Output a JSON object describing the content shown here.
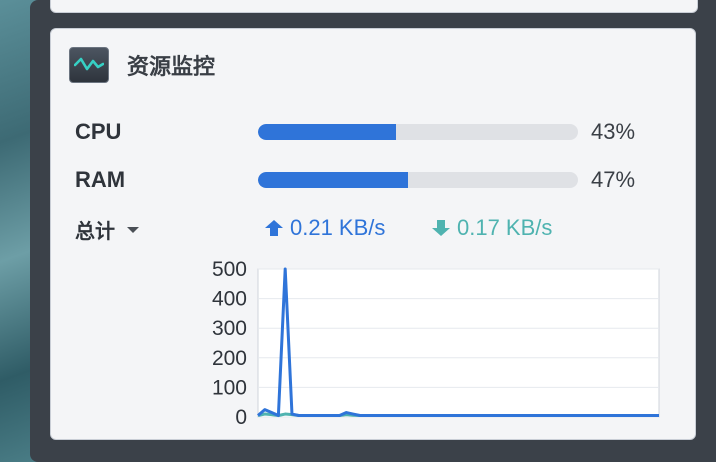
{
  "widget": {
    "title": "资源监控",
    "icon": "activity-monitor-icon"
  },
  "resources": [
    {
      "label": "CPU",
      "percent_text": "43%",
      "value": 0.43
    },
    {
      "label": "RAM",
      "percent_text": "47%",
      "value": 0.47
    }
  ],
  "network": {
    "filter_label": "总计",
    "upload": {
      "value": "0.21 KB/s",
      "icon": "upload-arrow-icon"
    },
    "download": {
      "value": "0.17 KB/s",
      "icon": "download-arrow-icon"
    }
  },
  "colors": {
    "accent": "#2f74d9",
    "upload": "#2f74d9",
    "download": "#4fb3b0",
    "bar_track": "#dfe1e5"
  },
  "chart_data": {
    "type": "line",
    "xlabel": "",
    "ylabel": "",
    "ylim": [
      0,
      500
    ],
    "yticks": [
      "500",
      "400",
      "300",
      "200",
      "100",
      "0"
    ],
    "x": [
      0,
      1,
      2,
      3,
      4,
      5,
      6,
      7,
      8,
      9,
      10,
      11,
      12,
      13,
      14,
      15,
      16,
      17,
      18,
      19,
      20,
      21,
      22,
      23,
      24,
      25,
      26,
      27,
      28,
      29,
      30,
      31,
      32,
      33,
      34,
      35,
      36,
      37,
      38,
      39,
      40,
      41,
      42,
      43,
      44,
      45,
      46,
      47,
      48,
      49,
      50,
      51,
      52,
      53,
      54,
      55,
      56,
      57,
      58,
      59
    ],
    "series": [
      {
        "values": [
          5,
          25,
          15,
          5,
          500,
          10,
          5,
          5,
          5,
          5,
          5,
          5,
          5,
          15,
          10,
          5,
          5,
          5,
          5,
          5,
          5,
          5,
          5,
          5,
          5,
          5,
          5,
          5,
          5,
          5,
          5,
          5,
          5,
          5,
          5,
          5,
          5,
          5,
          5,
          5,
          5,
          5,
          5,
          5,
          5,
          5,
          5,
          5,
          5,
          5,
          5,
          5,
          5,
          5,
          5,
          5,
          5,
          5,
          5,
          5
        ],
        "color": "#2f74d9"
      },
      {
        "values": [
          5,
          10,
          8,
          5,
          10,
          8,
          5,
          5,
          5,
          5,
          5,
          5,
          5,
          8,
          6,
          5,
          5,
          5,
          5,
          5,
          5,
          5,
          5,
          5,
          5,
          5,
          5,
          5,
          5,
          5,
          5,
          5,
          5,
          5,
          5,
          5,
          5,
          5,
          5,
          5,
          5,
          5,
          5,
          5,
          5,
          5,
          5,
          5,
          5,
          5,
          5,
          5,
          5,
          5,
          5,
          5,
          5,
          5,
          5,
          5
        ],
        "color": "#4fb3b0"
      }
    ],
    "grid": true,
    "legend": "none"
  }
}
